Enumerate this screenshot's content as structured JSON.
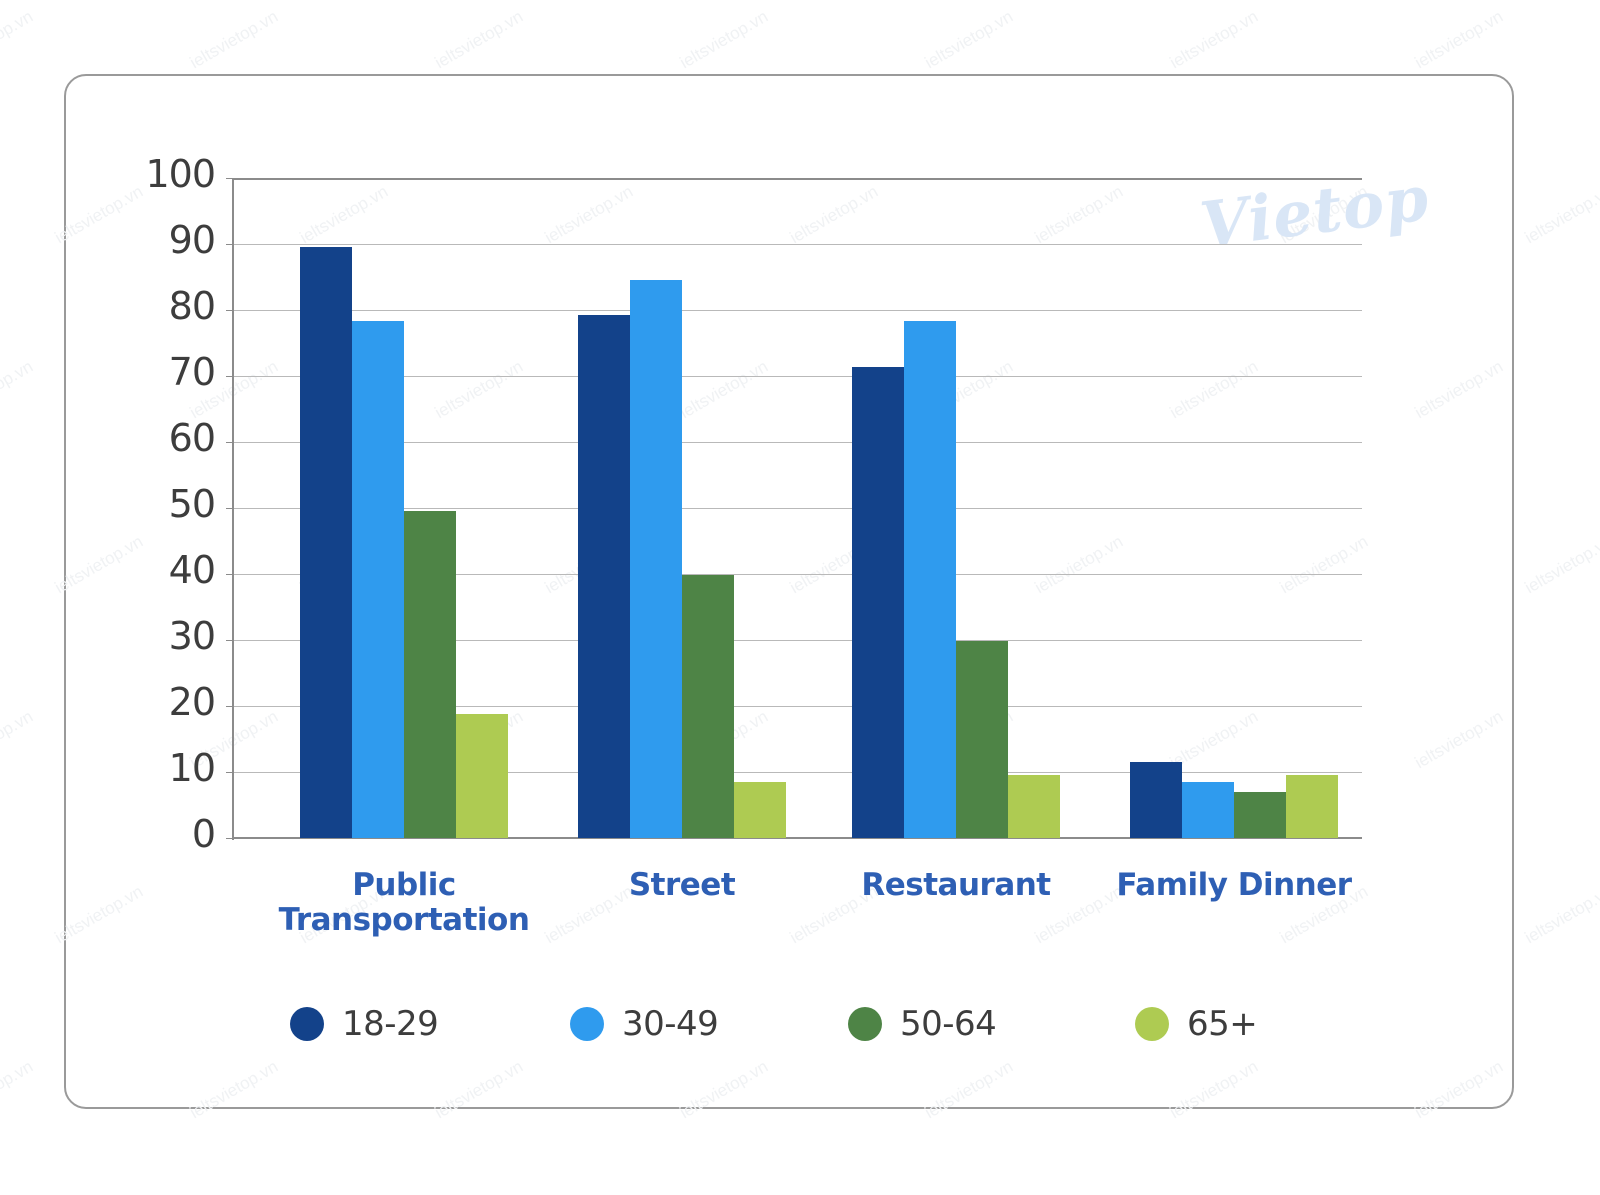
{
  "watermark": {
    "brand": "Vietop",
    "tile_text": "ieltsvietop.vn"
  },
  "chart_data": {
    "type": "bar",
    "title": "",
    "subtitle": "",
    "xlabel": "",
    "ylabel": "",
    "ylim": [
      0,
      100
    ],
    "ytick_labels": [
      "0",
      "10",
      "20",
      "30",
      "40",
      "50",
      "60",
      "70",
      "80",
      "90",
      "100"
    ],
    "yticks": [
      0,
      10,
      20,
      30,
      40,
      50,
      60,
      70,
      80,
      90,
      100
    ],
    "grid": "horizontal",
    "legend_position": "bottom",
    "categories": [
      "Public Transportation",
      "Street",
      "Restaurant",
      "Family Dinner"
    ],
    "series": [
      {
        "name": "18-29",
        "color": "#13428a",
        "values": [
          89.5,
          79.3,
          71.3,
          11.5
        ]
      },
      {
        "name": "30-49",
        "color": "#2f9bee",
        "values": [
          78.3,
          84.5,
          78.3,
          8.5
        ]
      },
      {
        "name": "50-64",
        "color": "#4e8446",
        "values": [
          49.5,
          39.8,
          29.8,
          7.0
        ]
      },
      {
        "name": "65+",
        "color": "#aecb52",
        "values": [
          18.8,
          8.5,
          9.6,
          9.6
        ]
      }
    ]
  },
  "colors": {
    "series_1": "#13428a",
    "series_2": "#2f9bee",
    "series_3": "#4e8446",
    "series_4": "#aecb52",
    "category_label": "#2e5fb4",
    "tick_label": "#3d3d3d",
    "gridline": "#b9b9b9",
    "card_border": "#9a9a9a",
    "watermark": "#d9e6f6"
  }
}
